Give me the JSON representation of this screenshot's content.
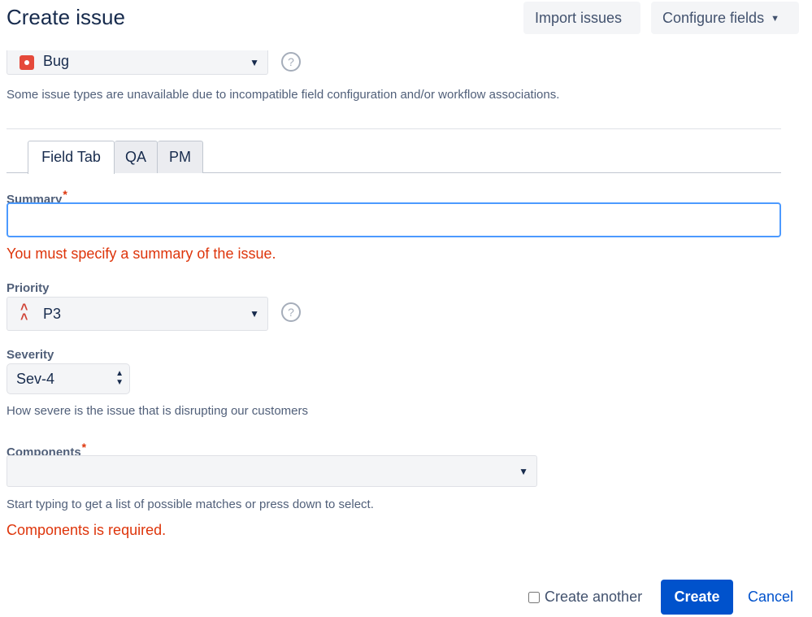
{
  "header": {
    "title": "Create issue",
    "import_label": "Import issues",
    "configure_label": "Configure fields"
  },
  "issue_type": {
    "value": "Bug",
    "note": "Some issue types are unavailable due to incompatible field configuration and/or workflow associations."
  },
  "tabs": [
    {
      "label": "Field Tab"
    },
    {
      "label": "QA"
    },
    {
      "label": "PM"
    }
  ],
  "summary": {
    "label": "Summary",
    "required_mark": "*",
    "value": "",
    "error": "You must specify a summary of the issue."
  },
  "priority": {
    "label": "Priority",
    "value": "P3"
  },
  "severity": {
    "label": "Severity",
    "value": "Sev-4",
    "description": "How severe is the issue that is disrupting our customers"
  },
  "components": {
    "label": "Components",
    "required_mark": "*",
    "value": "",
    "hint": "Start typing to get a list of possible matches or press down to select.",
    "error": "Components is required."
  },
  "footer": {
    "create_another_label": "Create another",
    "create_another_checked": false,
    "create_label": "Create",
    "cancel_label": "Cancel"
  },
  "colors": {
    "primary": "#0052cc",
    "error": "#de350b",
    "bug_icon": "#e5493a",
    "priority_icon": "#d04437"
  },
  "icons": {
    "bug": "bug-icon",
    "priority": "priority-high-icon",
    "help": "help-icon",
    "chevron": "chevron-down-icon"
  }
}
